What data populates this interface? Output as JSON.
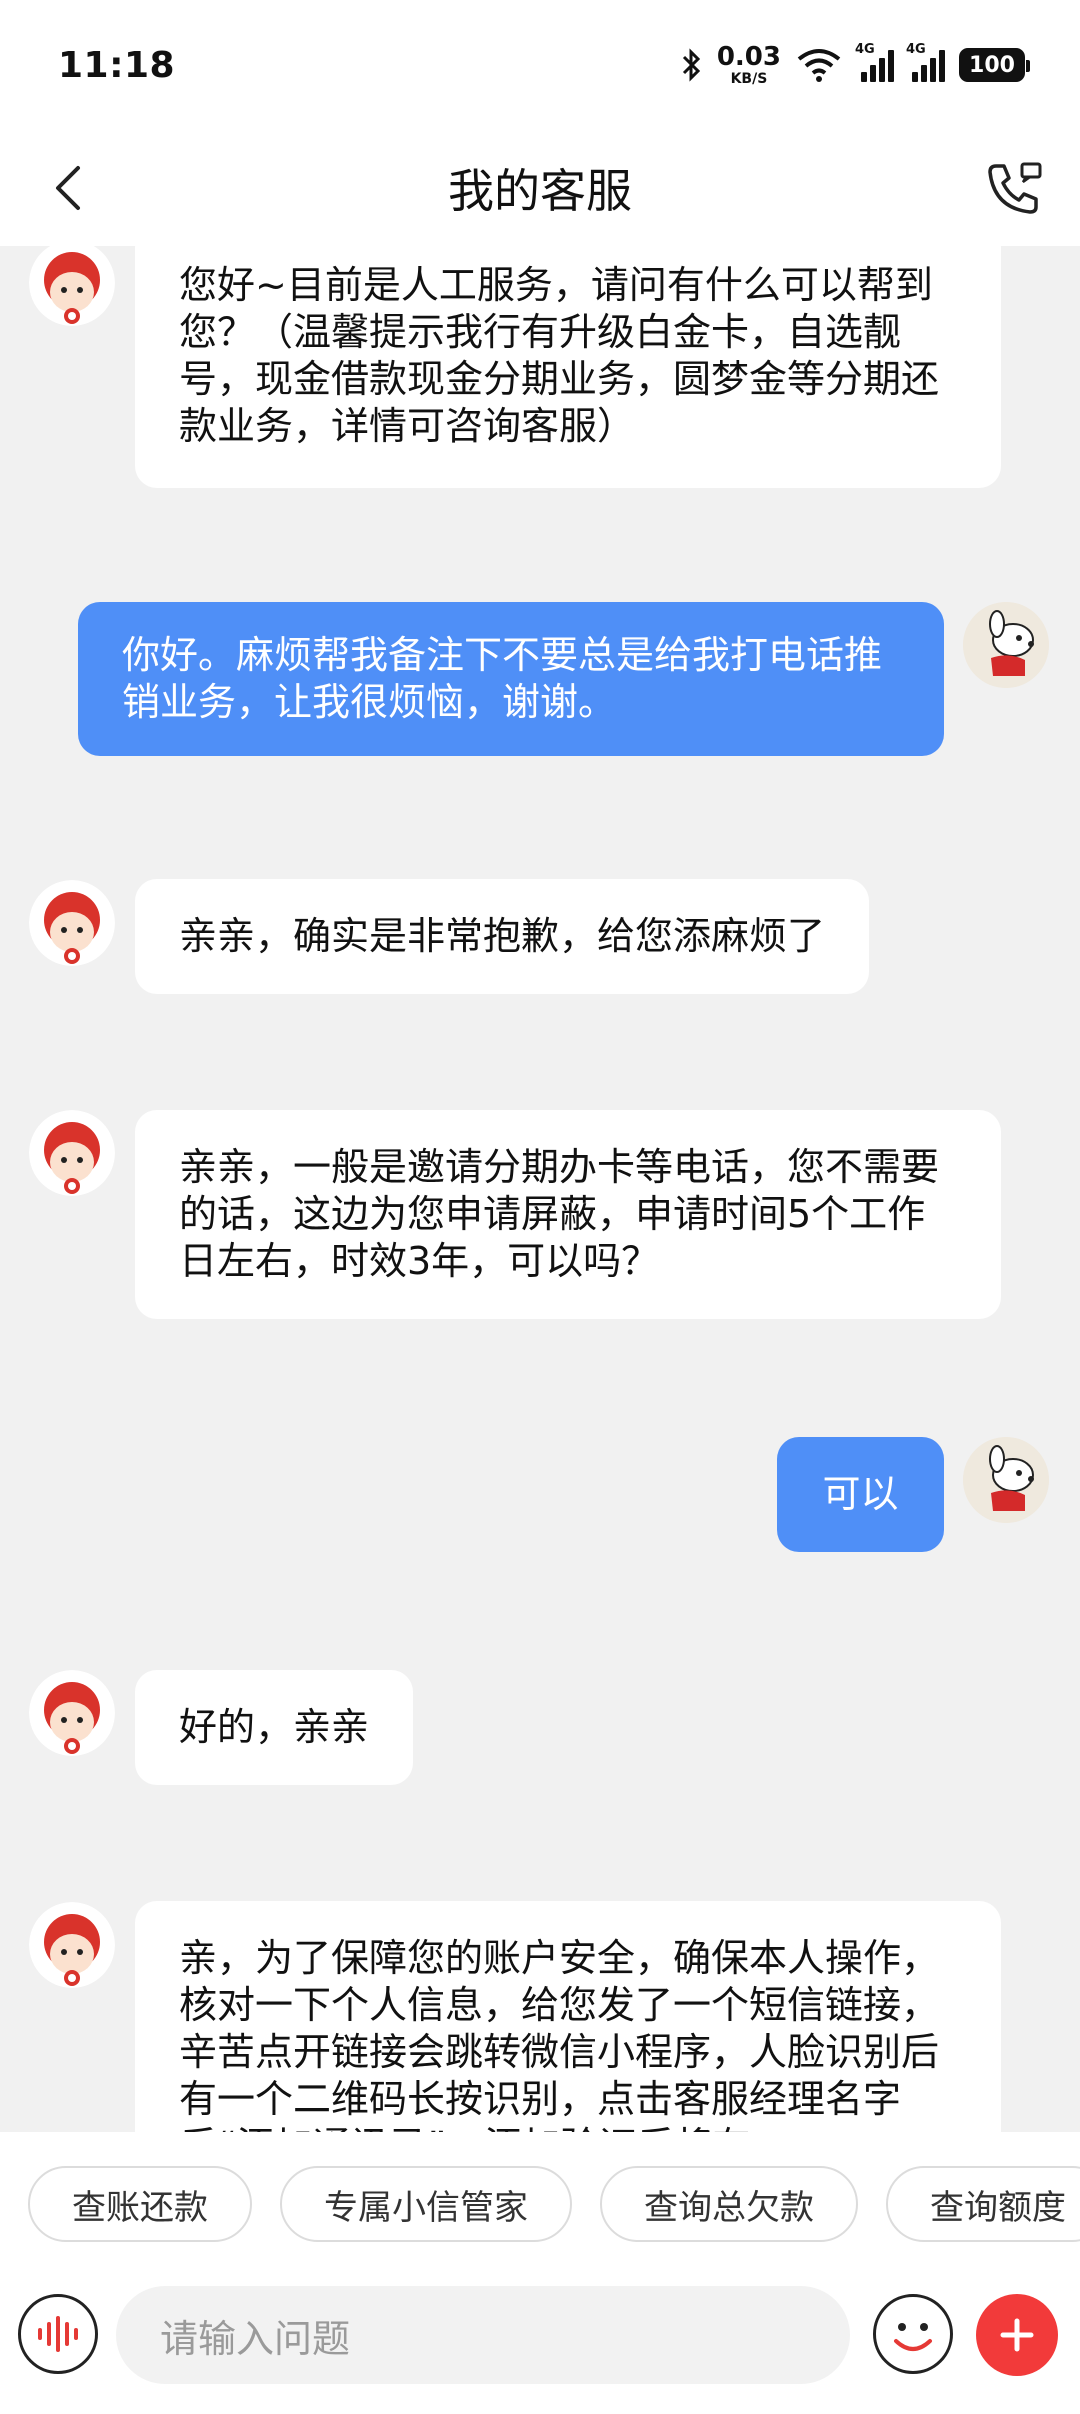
{
  "status_bar": {
    "time": "11:18",
    "net_speed_value": "0.03",
    "net_speed_unit": "KB/S",
    "sim1_tag": "4G",
    "sim2_tag": "4G",
    "battery": "100"
  },
  "header": {
    "title": "我的客服",
    "back_icon": "chevron-left-icon",
    "call_icon": "phone-call-icon"
  },
  "messages": [
    {
      "from": "bot",
      "text": "您好~目前是人工服务，请问有什么可以帮到您？（温馨提示我行有升级白金卡，自选靓号，现金借款现金分期业务，圆梦金等分期还款业务，详情可咨询客服）"
    },
    {
      "from": "user",
      "text": "你好。麻烦帮我备注下不要总是给我打电话推销业务，让我很烦恼，谢谢。"
    },
    {
      "from": "bot",
      "text": "亲亲，确实是非常抱歉，给您添麻烦了"
    },
    {
      "from": "bot",
      "text": "亲亲，一般是邀请分期办卡等电话，您不需要的话，这边为您申请屏蔽，申请时间5个工作日左右，时效3年，可以吗？"
    },
    {
      "from": "user",
      "text": "可以"
    },
    {
      "from": "bot",
      "text": "好的，亲亲"
    },
    {
      "from": "bot",
      "text": "亲，为了保障您的账户安全，确保本人操作，核对一下个人信息，给您发了一个短信链接，辛苦点开链接会跳转微信小程序，人脸识别后有一个二维码长按识别，点击客服经理名字后“添加通讯录”，添加验证后将有"
    }
  ],
  "quick_replies": [
    "查账还款",
    "专属小信管家",
    "查询总欠款",
    "查询额度"
  ],
  "input": {
    "placeholder": "请输入问题",
    "voice_icon": "voice-wave-icon",
    "emoji_icon": "smiley-icon",
    "plus_icon": "plus-icon"
  },
  "colors": {
    "user_bubble": "#4f8ff7",
    "plus_button": "#f23a3a",
    "chat_bg": "#f1f1f1"
  }
}
